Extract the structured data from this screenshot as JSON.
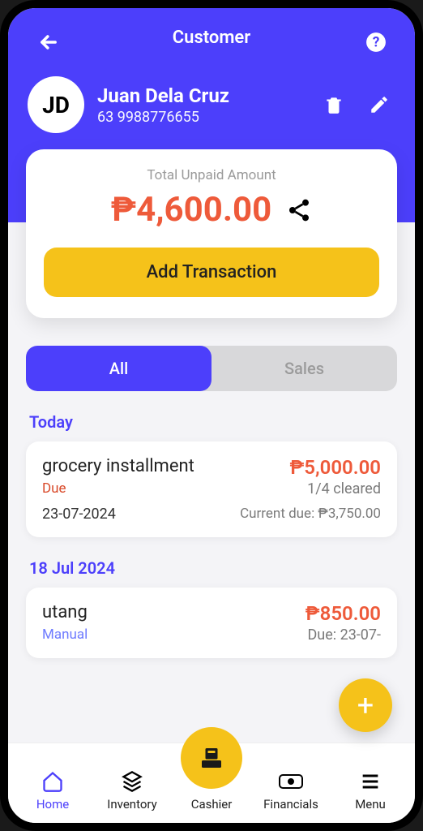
{
  "header": {
    "title": "Customer",
    "avatar_initials": "JD",
    "customer_name": "Juan Dela Cruz",
    "customer_phone": "63 9988776655"
  },
  "summary": {
    "unpaid_label": "Total Unpaid Amount",
    "unpaid_amount": "₱4,600.00",
    "add_button": "Add Transaction"
  },
  "tabs": {
    "all": "All",
    "sales": "Sales"
  },
  "sections": [
    {
      "date_label": "Today",
      "txns": [
        {
          "title": "grocery installment",
          "amount": "₱5,000.00",
          "sub_left": "Due",
          "sub_left_kind": "due",
          "sub_right": "1/4 cleared",
          "date": "23-07-2024",
          "current_due": "Current due: ₱3,750.00"
        }
      ]
    },
    {
      "date_label": "18 Jul 2024",
      "txns": [
        {
          "title": "utang",
          "amount": "₱850.00",
          "sub_left": "Manual",
          "sub_left_kind": "manual",
          "sub_right": "Due: 23-07-",
          "date": "",
          "current_due": ""
        }
      ]
    }
  ],
  "bottomnav": {
    "home": "Home",
    "inventory": "Inventory",
    "cashier": "Cashier",
    "financials": "Financials",
    "menu": "Menu"
  }
}
